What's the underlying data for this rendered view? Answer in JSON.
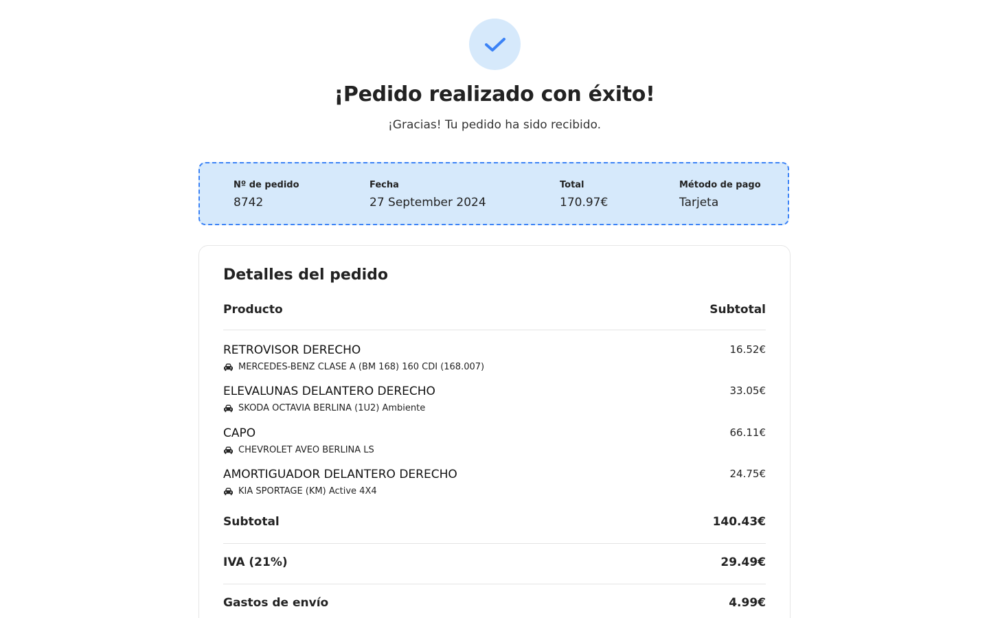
{
  "header": {
    "title": "¡Pedido realizado con éxito!",
    "subtitle": "¡Gracias! Tu pedido ha sido recibido.",
    "check_icon": "check-icon",
    "accent_color": "#3b82f6",
    "badge_bg": "#d6e9fb"
  },
  "summary": {
    "order_number_label": "Nº de pedido",
    "order_number": "8742",
    "date_label": "Fecha",
    "date": "27 September 2024",
    "total_label": "Total",
    "total": "170.97€",
    "payment_label": "Método de pago",
    "payment": "Tarjeta"
  },
  "details": {
    "title": "Detalles del pedido",
    "product_header": "Producto",
    "subtotal_header": "Subtotal",
    "items": [
      {
        "name": "RETROVISOR DERECHO",
        "car": "MERCEDES-BENZ CLASE A (BM 168) 160 CDI (168.007)",
        "price": "16.52€",
        "icon": "car-icon"
      },
      {
        "name": "ELEVALUNAS DELANTERO DERECHO",
        "car": "SKODA OCTAVIA BERLINA (1U2) Ambiente",
        "price": "33.05€",
        "icon": "car-icon"
      },
      {
        "name": "CAPO",
        "car": "CHEVROLET AVEO BERLINA LS",
        "price": "66.11€",
        "icon": "car-icon"
      },
      {
        "name": "AMORTIGUADOR DELANTERO DERECHO",
        "car": "KIA SPORTAGE (KM) Active 4X4",
        "price": "24.75€",
        "icon": "car-icon"
      }
    ],
    "totals": {
      "subtotal_label": "Subtotal",
      "subtotal": "140.43€",
      "tax_label": "IVA (21%)",
      "tax": "29.49€",
      "shipping_label": "Gastos de envío",
      "shipping": "4.99€"
    }
  }
}
